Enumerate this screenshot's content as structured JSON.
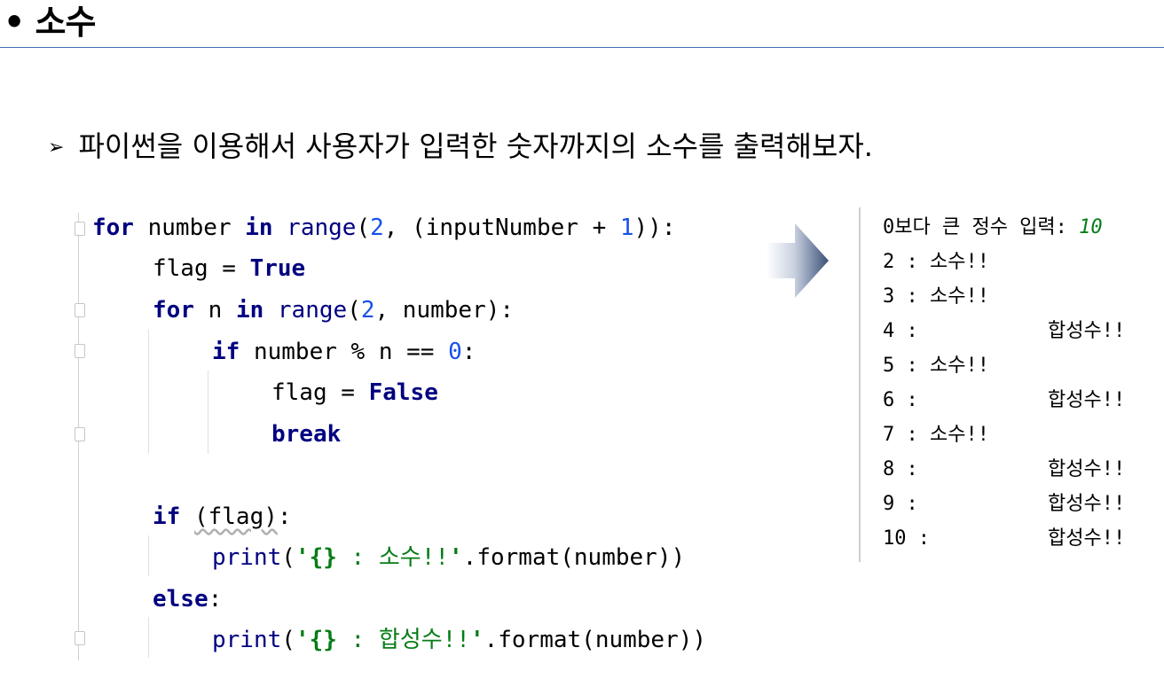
{
  "header": {
    "title": "• 소수"
  },
  "bullet": {
    "marker": "➢",
    "text": "파이썬을 이용해서 사용자가 입력한 숫자까지의 소수를 출력해보자."
  },
  "code": {
    "l1": {
      "kw_for": "for",
      "t1": " number ",
      "kw_in": "in",
      "t2": " ",
      "fn": "range",
      "t3": "(",
      "n2": "2",
      "t4": ", (inputNumber + ",
      "n1": "1",
      "t5": ")):"
    },
    "l2": {
      "t1": "flag = ",
      "kw_true": "True"
    },
    "l3": {
      "kw_for": "for",
      "t1": " n ",
      "kw_in": "in",
      "t2": " ",
      "fn": "range",
      "t3": "(",
      "n2": "2",
      "t4": ", number):"
    },
    "l4": {
      "kw_if": "if",
      "t1": " number % n == ",
      "n0": "0",
      "t2": ":"
    },
    "l5": {
      "t1": "flag = ",
      "kw_false": "False"
    },
    "l6": {
      "kw_break": "break"
    },
    "l7": {
      "kw_if": "if",
      "t1": " ",
      "arg": "(flag)",
      "t2": ":"
    },
    "l8": {
      "fn": "print",
      "t1": "(",
      "q1": "'",
      "br": "{}",
      "s": " : 소수!!",
      "q2": "'",
      "t2": ".format(number))"
    },
    "l9": {
      "kw_else": "else",
      "t1": ":"
    },
    "l10": {
      "fn": "print",
      "t1": "(",
      "q1": "'",
      "br": "{}",
      "s": " : 합성수!!",
      "q2": "'",
      "t2": ".format(number))"
    }
  },
  "console": {
    "prompt": "0보다 큰 정수 입력: ",
    "input": "10",
    "results": [
      {
        "label": "2 : 소수!!",
        "comp": ""
      },
      {
        "label": "3 : 소수!!",
        "comp": ""
      },
      {
        "label": "4 :",
        "comp": "합성수!!"
      },
      {
        "label": "5 : 소수!!",
        "comp": ""
      },
      {
        "label": "6 :",
        "comp": "합성수!!"
      },
      {
        "label": "7 : 소수!!",
        "comp": ""
      },
      {
        "label": "8 :",
        "comp": "합성수!!"
      },
      {
        "label": "9 :",
        "comp": "합성수!!"
      },
      {
        "label": "10 :",
        "comp": "합성수!!"
      }
    ]
  }
}
